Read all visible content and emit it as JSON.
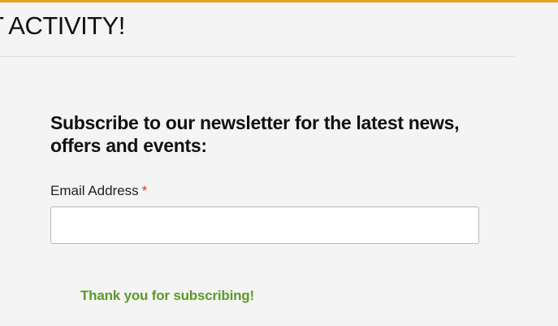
{
  "header": {
    "title_visible": "T ACTIVITY!",
    "accent_color": "#e0a31f"
  },
  "newsletter": {
    "title": "Subscribe to our newsletter for the latest news, offers and events:",
    "email_label": "Email Address",
    "required_marker": "*",
    "email_value": "",
    "email_placeholder": "",
    "success_message": "Thank you for subscribing!",
    "success_color": "#5b9a2b",
    "required_color": "#d9302c"
  }
}
